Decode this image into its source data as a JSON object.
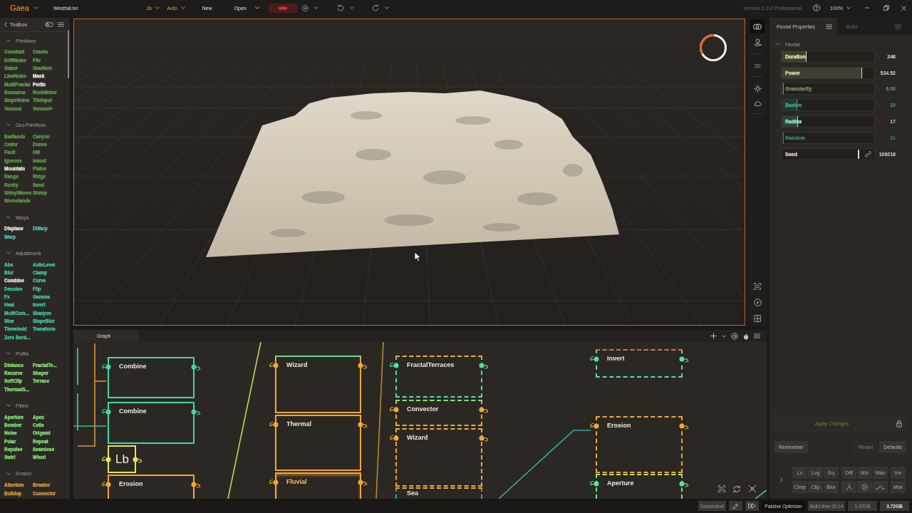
{
  "topbar": {
    "logo": "Gaea",
    "file": "Westfall.tor",
    "resolution": "2k",
    "quality": "Auto",
    "actions": [
      {
        "label": "New",
        "menu": false
      },
      {
        "label": "Open",
        "menu": true
      }
    ],
    "version": "Version 1.3.2 Professional",
    "zoom": "100%"
  },
  "toolbox": {
    "title": "Toolbox",
    "sections": [
      {
        "name": "Primitives",
        "expanded": true,
        "color": "#5fa84c",
        "items": [
          {
            "label": "Constant",
            "highlighted": false
          },
          {
            "label": "Cracks",
            "highlighted": false
          },
          {
            "label": "DriftNoise",
            "highlighted": false
          },
          {
            "label": "File",
            "highlighted": false
          },
          {
            "label": "Gabor",
            "highlighted": false
          },
          {
            "label": "Gradient",
            "highlighted": false
          },
          {
            "label": "LineNoise",
            "highlighted": false
          },
          {
            "label": "Mask",
            "highlighted": true
          },
          {
            "label": "MultiFractal",
            "highlighted": false
          },
          {
            "label": "Perlin",
            "highlighted": true
          },
          {
            "label": "Resource",
            "highlighted": false
          },
          {
            "label": "RockNoise",
            "highlighted": false
          },
          {
            "label": "SlopeNoise",
            "highlighted": false
          },
          {
            "label": "TileInput",
            "highlighted": false
          },
          {
            "label": "Voronoi",
            "highlighted": false
          },
          {
            "label": "Voronoi+",
            "highlighted": false
          }
        ]
      },
      {
        "name": "Geo Primitives",
        "expanded": true,
        "color": "#62a24e",
        "items": [
          {
            "label": "Badlands",
            "highlighted": false
          },
          {
            "label": "Canyon",
            "highlighted": false
          },
          {
            "label": "Crater",
            "highlighted": false
          },
          {
            "label": "Dunes",
            "highlighted": false
          },
          {
            "label": "Fault",
            "highlighted": false
          },
          {
            "label": "Hill",
            "highlighted": false
          },
          {
            "label": "Igneous",
            "highlighted": false
          },
          {
            "label": "Island",
            "highlighted": false
          },
          {
            "label": "Mountain",
            "highlighted": true
          },
          {
            "label": "Plates",
            "highlighted": false
          },
          {
            "label": "Range",
            "highlighted": false
          },
          {
            "label": "Ridge",
            "highlighted": false
          },
          {
            "label": "Rocky",
            "highlighted": false
          },
          {
            "label": "Sand",
            "highlighted": false
          },
          {
            "label": "ShinyWaves",
            "highlighted": false
          },
          {
            "label": "Slump",
            "highlighted": false
          },
          {
            "label": "Worselands",
            "highlighted": false
          }
        ]
      },
      {
        "name": "Warps",
        "expanded": true,
        "color": "#52c8bc",
        "items": [
          {
            "label": "Displace",
            "highlighted": true
          },
          {
            "label": "DWarp",
            "highlighted": false
          },
          {
            "label": "Warp",
            "highlighted": false
          }
        ]
      },
      {
        "name": "Adjustments",
        "expanded": true,
        "color": "#45cfa2",
        "items": [
          {
            "label": "Abs",
            "highlighted": false
          },
          {
            "label": "AutoLevel",
            "highlighted": false
          },
          {
            "label": "Blur",
            "highlighted": false
          },
          {
            "label": "Clamp",
            "highlighted": false
          },
          {
            "label": "Combine",
            "highlighted": true
          },
          {
            "label": "Curve",
            "highlighted": false
          },
          {
            "label": "Denoise",
            "highlighted": false
          },
          {
            "label": "Flip",
            "highlighted": false
          },
          {
            "label": "Fx",
            "highlighted": false
          },
          {
            "label": "Gamma",
            "highlighted": false
          },
          {
            "label": "Heal",
            "highlighted": false
          },
          {
            "label": "Invert",
            "highlighted": false
          },
          {
            "label": "MultiCom...",
            "highlighted": false
          },
          {
            "label": "Sharpen",
            "highlighted": false
          },
          {
            "label": "Sine",
            "highlighted": false
          },
          {
            "label": "SlopeBlur",
            "highlighted": false
          },
          {
            "label": "Threshold",
            "highlighted": false
          },
          {
            "label": "Transform",
            "highlighted": false
          },
          {
            "label": "Zero Bord...",
            "highlighted": false
          }
        ]
      },
      {
        "name": "Profile",
        "expanded": true,
        "color": "#8ee878",
        "items": [
          {
            "label": "Distance",
            "highlighted": false
          },
          {
            "label": "FractalTe...",
            "highlighted": false
          },
          {
            "label": "Recurve",
            "highlighted": false
          },
          {
            "label": "Shaper",
            "highlighted": false
          },
          {
            "label": "SoftClip",
            "highlighted": false
          },
          {
            "label": "Terrace",
            "highlighted": false
          },
          {
            "label": "ThermalS...",
            "highlighted": false
          }
        ]
      },
      {
        "name": "Filters",
        "expanded": true,
        "color": "#86ec7a",
        "items": [
          {
            "label": "Aperture",
            "highlighted": false
          },
          {
            "label": "Apex",
            "highlighted": false
          },
          {
            "label": "Bomber",
            "highlighted": false
          },
          {
            "label": "Cells",
            "highlighted": false
          },
          {
            "label": "Noise",
            "highlighted": false
          },
          {
            "label": "Origami",
            "highlighted": false
          },
          {
            "label": "Polar",
            "highlighted": false
          },
          {
            "label": "Repeat",
            "highlighted": false
          },
          {
            "label": "Repulse",
            "highlighted": false
          },
          {
            "label": "Seamless",
            "highlighted": false
          },
          {
            "label": "Swirl",
            "highlighted": false
          },
          {
            "label": "Whorl",
            "highlighted": false
          }
        ]
      },
      {
        "name": "Erosion",
        "expanded": true,
        "color": "#e0a040",
        "items": [
          {
            "label": "Alluvium",
            "highlighted": false
          },
          {
            "label": "Breaker",
            "highlighted": false
          },
          {
            "label": "Buildup",
            "highlighted": false
          },
          {
            "label": "Convector",
            "highlighted": false
          }
        ]
      }
    ]
  },
  "viewport": {
    "view_mode": "2D",
    "busy": true
  },
  "properties": {
    "tabs": [
      {
        "label": "Fluvial Properties",
        "selected": true
      },
      {
        "label": "Build",
        "selected": false
      }
    ],
    "group": {
      "name": "Fluvial",
      "expanded": true
    },
    "fields": [
      {
        "kind": "slider",
        "label": "Duration",
        "value": "246",
        "level": 0.27,
        "color": "#ece6a8"
      },
      {
        "kind": "slider",
        "label": "Power",
        "value": "534.52",
        "level": 0.87,
        "color": "#e2dcb8"
      },
      {
        "kind": "slider",
        "label": "Granularity",
        "value": "6.00",
        "level": 0.02,
        "color": "#76985f"
      },
      {
        "kind": "slider",
        "label": "Baslen",
        "value": "10",
        "level": 0.17,
        "color": "#3fae8c"
      },
      {
        "kind": "slider",
        "label": "Radius",
        "value": "17",
        "level": 0.18,
        "color": "#8af0c4"
      },
      {
        "kind": "slider",
        "label": "Random",
        "value": "01",
        "level": 0.02,
        "color": "#3d8c6e"
      },
      {
        "kind": "seed",
        "label": "Seed",
        "value": "109218",
        "color": "#ead2e2"
      }
    ],
    "apply": {
      "label": "Apply Changes",
      "disabled": true
    },
    "actions": [
      {
        "label": "Remember",
        "disabled": false
      },
      {
        "label": "Revert",
        "disabled": true
      },
      {
        "label": "Defaults",
        "disabled": false
      }
    ],
    "quick_tools": [
      [
        [
          {
            "kind": "text",
            "label": "Lv"
          },
          {
            "kind": "text",
            "label": "Log"
          },
          {
            "kind": "text",
            "label": "Eq"
          }
        ],
        [
          {
            "kind": "text",
            "label": "Diff"
          },
          {
            "kind": "text",
            "label": "Min"
          },
          {
            "kind": "text",
            "label": "Max"
          }
        ],
        [
          {
            "kind": "text",
            "label": "Inv"
          }
        ]
      ],
      [
        [
          {
            "kind": "text",
            "label": "Clmp"
          },
          {
            "kind": "text",
            "label": "Clip"
          },
          {
            "kind": "text",
            "label": "Blur"
          }
        ],
        [
          {
            "kind": "icon"
          },
          {
            "kind": "icon"
          },
          {
            "kind": "icon"
          }
        ],
        [
          {
            "kind": "text",
            "label": "Msk"
          }
        ]
      ]
    ]
  },
  "graph": {
    "title": "Graph",
    "nodes": [
      {
        "kind": "node",
        "title": "Combine",
        "color": "#45d6a8",
        "dashed": false,
        "selected": false
      },
      {
        "kind": "node",
        "title": "Combine",
        "color": "#45d6a8",
        "dashed": false,
        "selected": false
      },
      {
        "kind": "label",
        "title": "Lb",
        "color": "#e4e652",
        "dashed": false,
        "selected": false
      },
      {
        "kind": "node",
        "title": "Erosion",
        "color": "#f2a834",
        "dashed": false,
        "selected": false
      },
      {
        "kind": "node",
        "title": "Wizard",
        "color": "#f2a834",
        "top_edge": {
          "color": "#62e08c"
        },
        "dashed": false,
        "selected": false
      },
      {
        "kind": "node",
        "title": "Thermal",
        "color": "#f2a834",
        "dashed": false,
        "selected": false
      },
      {
        "kind": "node",
        "title": "Fluvial",
        "color": "#f2a834",
        "dashed": false,
        "selected": true
      },
      {
        "kind": "node",
        "title": "FractalTerraces",
        "color": "#52e0a4",
        "top_edge": {
          "color": "#f2a834"
        },
        "dashed": true,
        "selected": false
      },
      {
        "kind": "node",
        "title": "Convector",
        "color": "#f2a834",
        "top_edge": {
          "color": "#82e070"
        },
        "dashed": true,
        "selected": false
      },
      {
        "kind": "node",
        "title": "Wizard",
        "color": "#f2a834",
        "dashed": true,
        "selected": false
      },
      {
        "kind": "node",
        "title": "Sea",
        "color": "#3c9cc4",
        "top_edge": {
          "color": "#f2a834"
        },
        "dashed": true,
        "selected": false
      },
      {
        "kind": "node",
        "title": "Invert",
        "color": "#52dcb0",
        "top_edge": {
          "color": "#e06a50"
        },
        "dashed": true,
        "selected": false
      },
      {
        "kind": "node",
        "title": "Erosion",
        "color": "#f2a834",
        "dashed": true,
        "selected": false
      },
      {
        "kind": "node",
        "title": "Aperture",
        "color": "#5ee890",
        "top_edge": {
          "color": "#b4e860"
        },
        "dashed": true,
        "selected": false
      }
    ]
  },
  "status_bar": {
    "screenshot": "Screenshot",
    "optimizer": "Passive Optimizer",
    "build_time": "Build time 00:14",
    "memory": [
      {
        "value": "1.22GB",
        "highlighted": false
      },
      {
        "value": "3.72GB",
        "highlighted": true
      }
    ]
  }
}
